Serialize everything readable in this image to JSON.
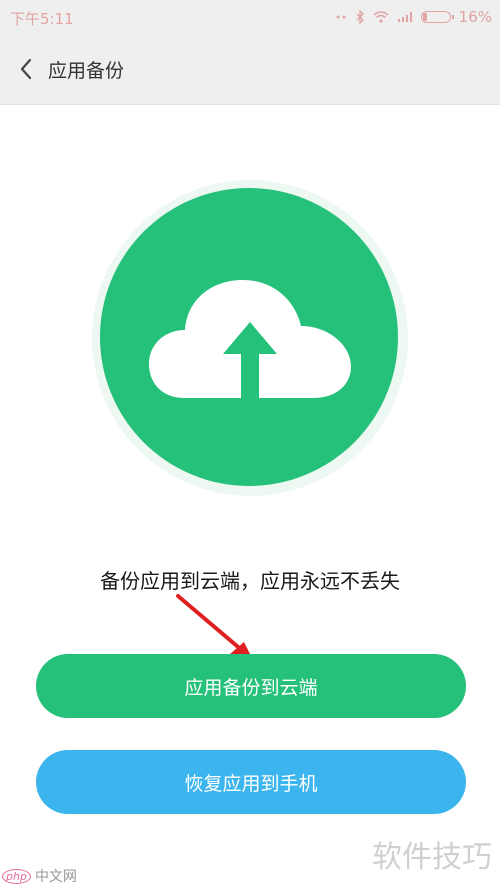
{
  "status_bar": {
    "time": "下午5:11",
    "battery": "16%",
    "battery_level": 0.16,
    "icons": [
      "dots-icon",
      "bluetooth-icon",
      "wifi-icon",
      "signal-icon",
      "battery-icon"
    ],
    "color": "#e0a4a4"
  },
  "header": {
    "title": "应用备份",
    "back_icon": "chevron-left-icon"
  },
  "hero": {
    "icon": "cloud-upload-icon",
    "circle_color": "#25c17a"
  },
  "main": {
    "tagline": "备份应用到云端，应用永远不丢失"
  },
  "actions": {
    "backup_label": "应用备份到云端",
    "backup_color": "#25c17a",
    "restore_label": "恢复应用到手机",
    "restore_color": "#3cb4ee"
  },
  "watermark": {
    "right_text": "软件技巧",
    "left_badge": "php",
    "left_text": "中文网"
  }
}
